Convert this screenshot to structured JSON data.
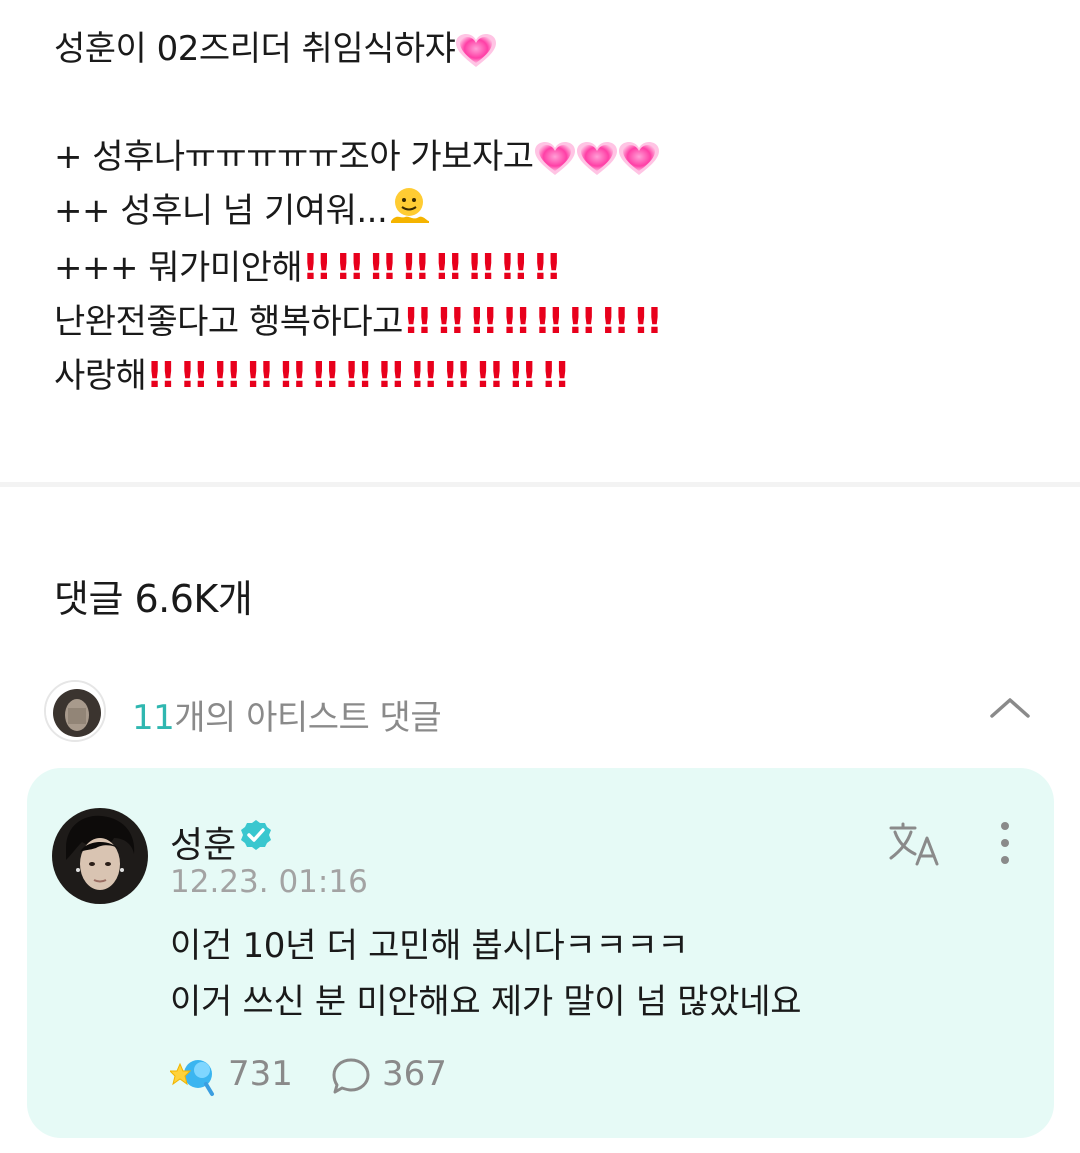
{
  "post": {
    "line1": "성훈이 02즈리더 취임식하쟈",
    "line2": "+ 성후나ㅠㅠㅠㅠㅠ조아 가보자고",
    "line3": "++ 성후니 넘 기여워...",
    "line4": "+++ 뭐가미안해",
    "line5": "난완전좋다고 행복하다고",
    "line6": "사랑해",
    "bang": "!!"
  },
  "comments": {
    "count_label": "댓글 6.6K개"
  },
  "artist_comments": {
    "count": "11",
    "label": "개의 아티스트 댓글"
  },
  "comment": {
    "author": "성훈",
    "timestamp": "12.23. 01:16",
    "text_line1": "이건 10년 더 고민해 봅시다ㅋㅋㅋㅋ",
    "text_line2": "이거 쓰신 분 미안해요 제가 말이 넘 많았네요",
    "likes": "731",
    "replies": "367"
  },
  "colors": {
    "accent": "#2fb7b0",
    "card_bg": "#e6faf6",
    "bang": "#e8001c",
    "heart": "#ff3fa6"
  },
  "icons": [
    "heart-emoji",
    "melting-face-emoji",
    "double-exclamation-emoji",
    "chevron-up-icon",
    "verified-icon",
    "translate-icon",
    "more-vertical-icon",
    "like-icon",
    "reply-icon"
  ]
}
